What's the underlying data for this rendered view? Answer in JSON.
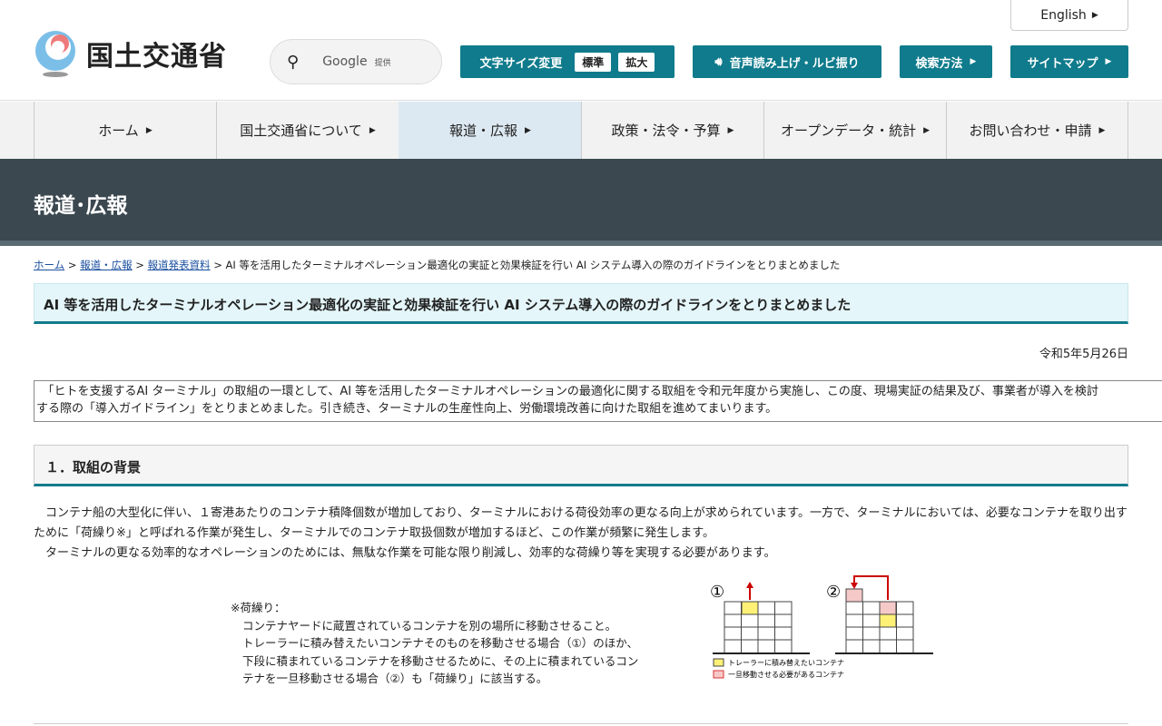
{
  "header": {
    "logo_text": "国土交通省",
    "english": "English",
    "search_provider": "Google",
    "search_provided": "提供",
    "font_size_label": "文字サイズ変更",
    "font_standard": "標準",
    "font_large": "拡大",
    "voice_label": "音声読み上げ・ルビ振り",
    "search_method": "検索方法",
    "sitemap": "サイトマップ"
  },
  "nav": [
    "ホーム",
    "国土交通省について",
    "報道・広報",
    "政策・法令・予算",
    "オープンデータ・統計",
    "お問い合わせ・申請"
  ],
  "banner_title": "報道･広報",
  "breadcrumb": {
    "items": [
      "ホーム",
      "報道・広報",
      "報道発表資料"
    ],
    "current": "AI 等を活用したターミナルオペレーション最適化の実証と効果検証を行い AI システム導入の際のガイドラインをとりまとめました"
  },
  "title": "AI 等を活用したターミナルオペレーション最適化の実証と効果検証を行い AI システム導入の際のガイドラインをとりまとめました",
  "date": "令和5年5月26日",
  "intro": [
    "　「ヒトを支援するAI ターミナル」の取組の一環として、AI 等を活用したターミナルオペレーションの最適化に関する取組を令和元年度から実施し、この度、現場実証の結果及び、事業者が導入を検討",
    "する際の「導入ガイドライン」をとりまとめました。引き続き、ターミナルの生産性向上、労働環境改善に向けた取組を進めてまいります。"
  ],
  "section1": {
    "heading": "１．取組の背景",
    "paragraphs": [
      "　コンテナ船の大型化に伴い、１寄港あたりのコンテナ積降個数が増加しており、ターミナルにおける荷役効率の更なる向上が求められています。一方で、ターミナルにおいては、必要なコンテナを取り出すために「荷繰り※」と呼ばれる作業が発生し、ターミナルでのコンテナ取扱個数が増加するほど、この作業が頻繁に発生します。",
      "　ターミナルの更なる効率的なオペレーションのためには、無駄な作業を可能な限り削減し、効率的な荷繰り等を実現する必要があります。"
    ]
  },
  "figure": {
    "note_title": "※荷繰り：",
    "note_lines": [
      "コンテナヤードに蔵置されているコンテナを別の場所に移動させること。",
      "トレーラーに積み替えたいコンテナそのものを移動させる場合（①）のほか、",
      "下段に積まれているコンテナを移動させるために、その上に積まれているコン",
      "テナを一旦移動させる場合（②）も「荷繰り」に該当する。"
    ],
    "label1": "①",
    "label2": "②",
    "legend_yellow": "トレーラーに積み替えたいコンテナ",
    "legend_red": "一旦移動させる必要があるコンテナ"
  }
}
